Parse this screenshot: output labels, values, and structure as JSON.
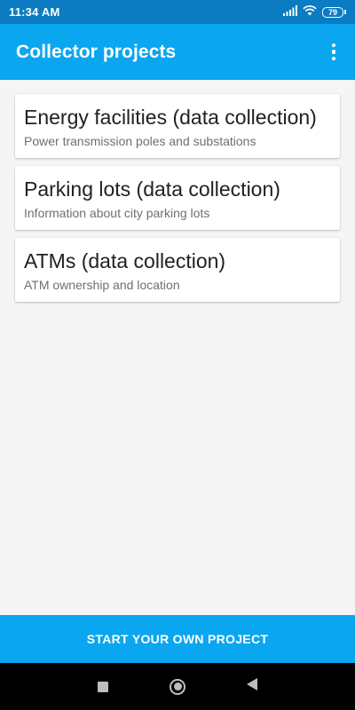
{
  "status_bar": {
    "time": "11:34 AM",
    "battery": "79",
    "icons": [
      "signal-icon",
      "wifi-icon",
      "battery-icon"
    ]
  },
  "app_bar": {
    "title": "Collector projects",
    "menu_icon": "overflow-menu-icon"
  },
  "projects": [
    {
      "title": "Energy facilities (data collection)",
      "subtitle": "Power transmission poles and substations"
    },
    {
      "title": "Parking lots (data collection)",
      "subtitle": "Information about city parking lots"
    },
    {
      "title": "ATMs (data collection)",
      "subtitle": "ATM ownership and location"
    }
  ],
  "footer": {
    "start_label": "START YOUR OWN PROJECT"
  },
  "nav_bar": {
    "icons": [
      "recents-square-icon",
      "home-circle-icon",
      "back-triangle-icon"
    ]
  },
  "colors": {
    "status_bar": "#0b7cc1",
    "primary": "#0aa6f0",
    "background": "#f5f5f5",
    "nav_bar": "#000000"
  }
}
